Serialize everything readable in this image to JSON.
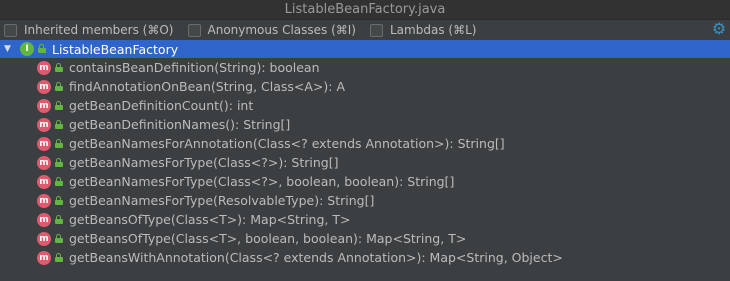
{
  "window": {
    "title": "ListableBeanFactory.java"
  },
  "toolbar": {
    "options": [
      {
        "label": "Inherited members (⌘O)",
        "checked": false
      },
      {
        "label": "Anonymous Classes (⌘I)",
        "checked": false
      },
      {
        "label": "Lambdas (⌘L)",
        "checked": false
      }
    ],
    "settings_icon": "gear-icon"
  },
  "tree": {
    "root": {
      "label": "ListableBeanFactory",
      "icon": "interface-icon",
      "expanded": true,
      "selected": true
    },
    "methods": [
      {
        "label": "containsBeanDefinition(String): boolean"
      },
      {
        "label": "findAnnotationOnBean(String, Class<A>): A"
      },
      {
        "label": "getBeanDefinitionCount(): int"
      },
      {
        "label": "getBeanDefinitionNames(): String[]"
      },
      {
        "label": "getBeanNamesForAnnotation(Class<? extends Annotation>): String[]"
      },
      {
        "label": "getBeanNamesForType(Class<?>): String[]"
      },
      {
        "label": "getBeanNamesForType(Class<?>, boolean, boolean): String[]"
      },
      {
        "label": "getBeanNamesForType(ResolvableType): String[]"
      },
      {
        "label": "getBeansOfType(Class<T>): Map<String, T>"
      },
      {
        "label": "getBeansOfType(Class<T>, boolean, boolean): Map<String, T>"
      },
      {
        "label": "getBeansWithAnnotation(Class<? extends Annotation>): Map<String, Object>"
      }
    ]
  },
  "colors": {
    "background": "#3c3f41",
    "selection": "#2f65ca",
    "method_badge": "#e05a6f",
    "interface_badge": "#62b543",
    "public_lock": "#62b543",
    "accent": "#3592c4"
  }
}
